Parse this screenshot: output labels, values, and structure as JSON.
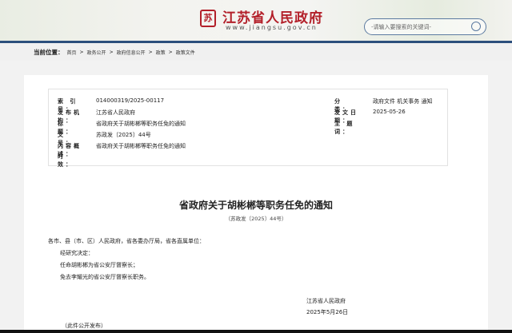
{
  "header": {
    "logo_glyph": "苏",
    "site_title": "江苏省人民政府",
    "site_url": "www.jiangsu.gov.cn",
    "search_placeholder": "-请输入要搜索的关键词-"
  },
  "breadcrumb": {
    "label": "当前位置：",
    "items": [
      "首页",
      "政务公开",
      "政府信息公开",
      "政策",
      "政策文件"
    ],
    "separator": ">"
  },
  "meta": {
    "left": [
      {
        "k": "索 引 号：",
        "v": "014000319/2025-00117"
      },
      {
        "k": "发布机构：",
        "v": "江苏省人民政府"
      },
      {
        "k": "标　　题：",
        "v": "省政府关于胡彬郴等职务任免的通知"
      },
      {
        "k": "文　　号：",
        "v": "苏政发〔2025〕44号"
      },
      {
        "k": "内容概述：",
        "v": "省政府关于胡彬郴等职务任免的通知"
      },
      {
        "k": "时　　效：",
        "v": ""
      }
    ],
    "right": [
      {
        "k": "分　　类：",
        "v": "政府文件 机关事务 通知"
      },
      {
        "k": "发文日期：",
        "v": "2025-05-26"
      },
      {
        "k": "主 题 词：",
        "v": ""
      }
    ]
  },
  "doc": {
    "title": "省政府关于胡彬郴等职务任免的通知",
    "number": "（苏政发〔2025〕44号）",
    "salutation": "各市、县（市、区）人民政府，省各委办厅局，省各直属单位：",
    "paragraphs": [
      "经研究决定：",
      "任命胡彬郴为省公安厅督察长；",
      "免去李耀光的省公安厅督察长职务。"
    ],
    "signer": "江苏省人民政府",
    "date": "2025年5月26日",
    "note": "（此件公开发布）"
  }
}
